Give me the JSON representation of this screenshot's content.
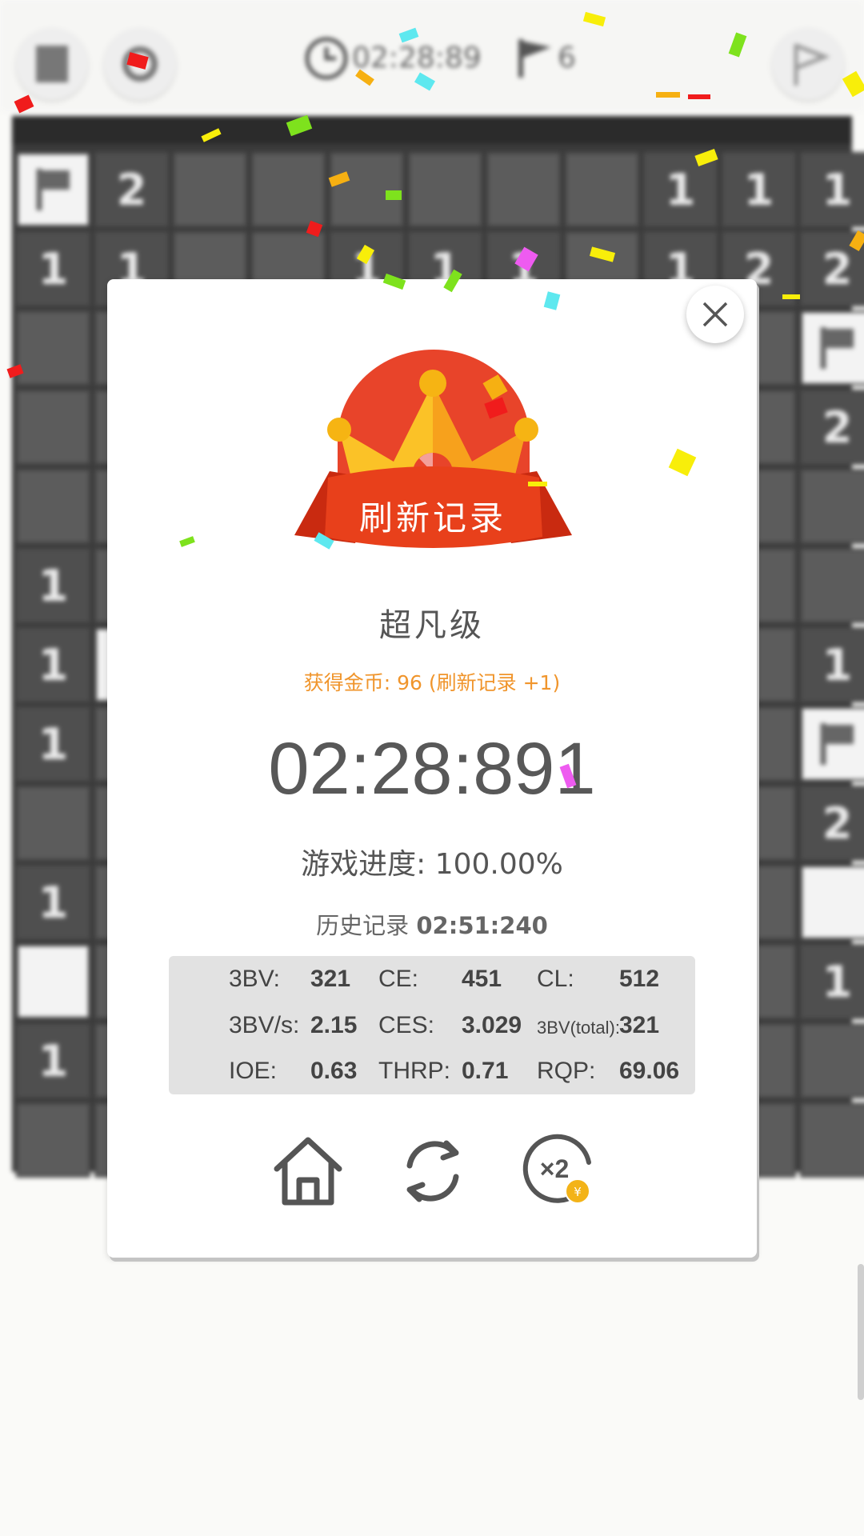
{
  "topbar": {
    "timer": "02:28:89",
    "flags_count": "6"
  },
  "board": {
    "rows": [
      [
        "F",
        "2",
        "",
        "",
        "",
        "",
        "",
        "",
        "1",
        "1",
        "1"
      ],
      [
        "1",
        "1",
        "",
        "",
        "1",
        "1",
        "1",
        "",
        "1",
        "2",
        "2"
      ],
      [
        "",
        "",
        "",
        "",
        "",
        "",
        "",
        "",
        "",
        "",
        "F"
      ],
      [
        "",
        "",
        "",
        "",
        "",
        "",
        "",
        "",
        "",
        "",
        "2"
      ],
      [
        "",
        "",
        "",
        "",
        "",
        "",
        "",
        "",
        "",
        "",
        ""
      ],
      [
        "1",
        "",
        "",
        "",
        "",
        "",
        "",
        "",
        "",
        "",
        ""
      ],
      [
        "1",
        "W",
        "",
        "",
        "",
        "",
        "",
        "",
        "",
        "",
        "1"
      ],
      [
        "1",
        "",
        "",
        "",
        "",
        "",
        "",
        "",
        "",
        "",
        "F"
      ],
      [
        "",
        "",
        "",
        "",
        "",
        "",
        "",
        "",
        "",
        "",
        "2"
      ],
      [
        "1",
        "",
        "",
        "",
        "",
        "",
        "",
        "",
        "",
        "",
        "W"
      ],
      [
        "W",
        "",
        "",
        "",
        "",
        "",
        "",
        "",
        "",
        "",
        "1"
      ],
      [
        "1",
        "",
        "",
        "",
        "",
        "",
        "",
        "",
        "",
        "",
        ""
      ],
      [
        "",
        "",
        "",
        "",
        "",
        "",
        "",
        "",
        "",
        "",
        ""
      ]
    ]
  },
  "dialog": {
    "banner": "刷新记录",
    "level": "超凡级",
    "coins": "获得金币: 96 (刷新记录 +1)",
    "time": "02:28:891",
    "progress": "游戏进度:  100.00%",
    "history_label": "历史记录 ",
    "history_value": "02:51:240",
    "stats": {
      "bv_label": "3BV:",
      "bv": "321",
      "ce_label": "CE:",
      "ce": "451",
      "cl_label": "CL:",
      "cl": "512",
      "bvs_label": "3BV/s:",
      "bvs": "2.15",
      "ces_label": "CES:",
      "ces": "3.029",
      "bvt_label": "3BV(total):",
      "bvt": "321",
      "ioe_label": "IOE:",
      "ioe": "0.63",
      "thrp_label": "THRP:",
      "thrp": "0.71",
      "rqp_label": "RQP:",
      "rqp": "69.06"
    },
    "buttons": {
      "home_icon": "home-icon",
      "restart_icon": "restart-icon",
      "double_icon": "double-reward-icon",
      "double_label": "×2",
      "coin_label": "¥"
    }
  },
  "colors": {
    "accent_orange": "#f0952c",
    "banner_red": "#e8401b",
    "crown_yellow": "#fbc227"
  }
}
